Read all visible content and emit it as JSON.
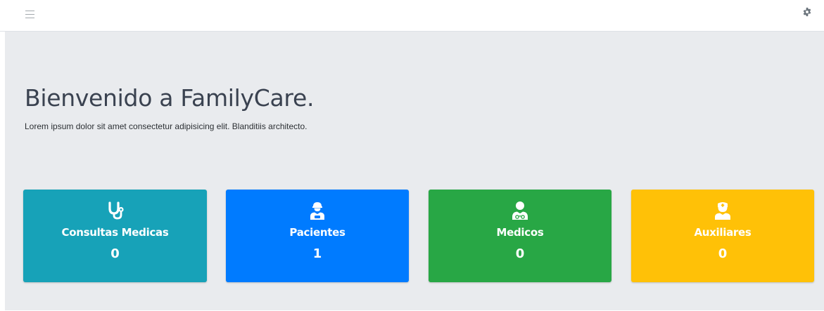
{
  "topbar": {
    "menu_icon": "hamburger-icon",
    "settings_icon": "gear-icon"
  },
  "hero": {
    "title": "Bienvenido a FamilyCare.",
    "subtitle": "Lorem ipsum dolor sit amet consectetur adipisicing elit. Blanditiis architecto."
  },
  "cards": [
    {
      "label": "Consultas Medicas",
      "count": "0",
      "icon": "stethoscope-icon",
      "color": "#17a2b8"
    },
    {
      "label": "Pacientes",
      "count": "1",
      "icon": "patient-icon",
      "color": "#007bff"
    },
    {
      "label": "Medicos",
      "count": "0",
      "icon": "doctor-icon",
      "color": "#28a745"
    },
    {
      "label": "Auxiliares",
      "count": "0",
      "icon": "nurse-icon",
      "color": "#ffc107"
    }
  ]
}
